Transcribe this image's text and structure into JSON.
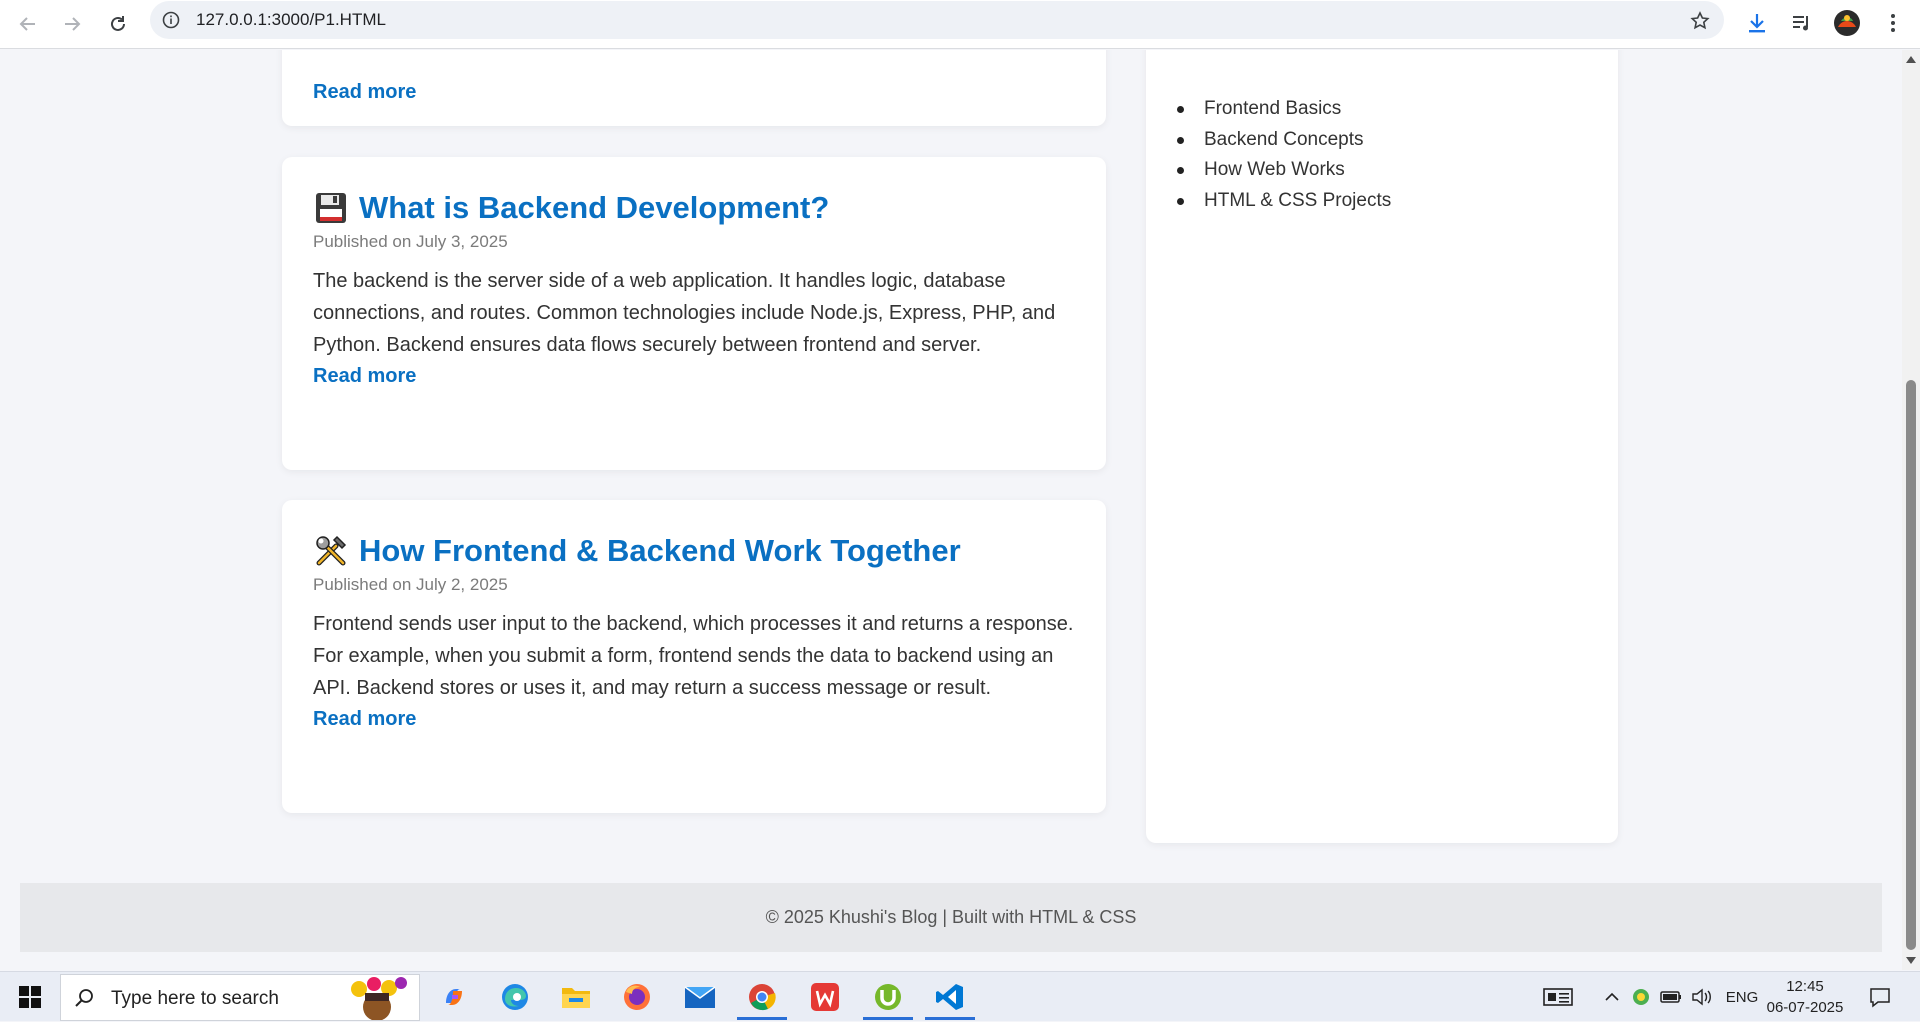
{
  "browser": {
    "url": "127.0.0.1:3000/P1.HTML"
  },
  "articles": [
    {
      "title": "",
      "date": "",
      "body": "",
      "read_more": "Read more"
    },
    {
      "icon": "floppy-disk-icon",
      "title": "What is Backend Development?",
      "date": "Published on July 3, 2025",
      "body": "The backend is the server side of a web application. It handles logic, database connections, and routes. Common technologies include Node.js, Express, PHP, and Python. Backend ensures data flows securely between frontend and server.",
      "read_more": "Read more"
    },
    {
      "icon": "tools-icon",
      "title": "How Frontend & Backend Work Together",
      "date": "Published on July 2, 2025",
      "body": "Frontend sends user input to the backend, which processes it and returns a response. For example, when you submit a form, frontend sends the data to backend using an API. Backend stores or uses it, and may return a success message or result.",
      "read_more": "Read more"
    }
  ],
  "sidebar": {
    "categories": [
      "Frontend Basics",
      "Backend Concepts",
      "How Web Works",
      "HTML & CSS Projects"
    ]
  },
  "footer": {
    "text": "© 2025 Khushi's Blog | Built with HTML & CSS"
  },
  "taskbar": {
    "search_placeholder": "Type here to search",
    "language": "ENG",
    "time": "12:45",
    "date": "06-07-2025",
    "apps": [
      "copilot-icon",
      "edge-icon",
      "file-explorer-icon",
      "firefox-icon",
      "mail-icon",
      "chrome-icon",
      "wps-office-icon",
      "utorrent-icon",
      "vscode-icon"
    ]
  },
  "colors": {
    "accent": "#0a70c2",
    "page_bg": "#f4f5f9",
    "card_bg": "#ffffff",
    "footer_bg": "#e7e8eb"
  }
}
